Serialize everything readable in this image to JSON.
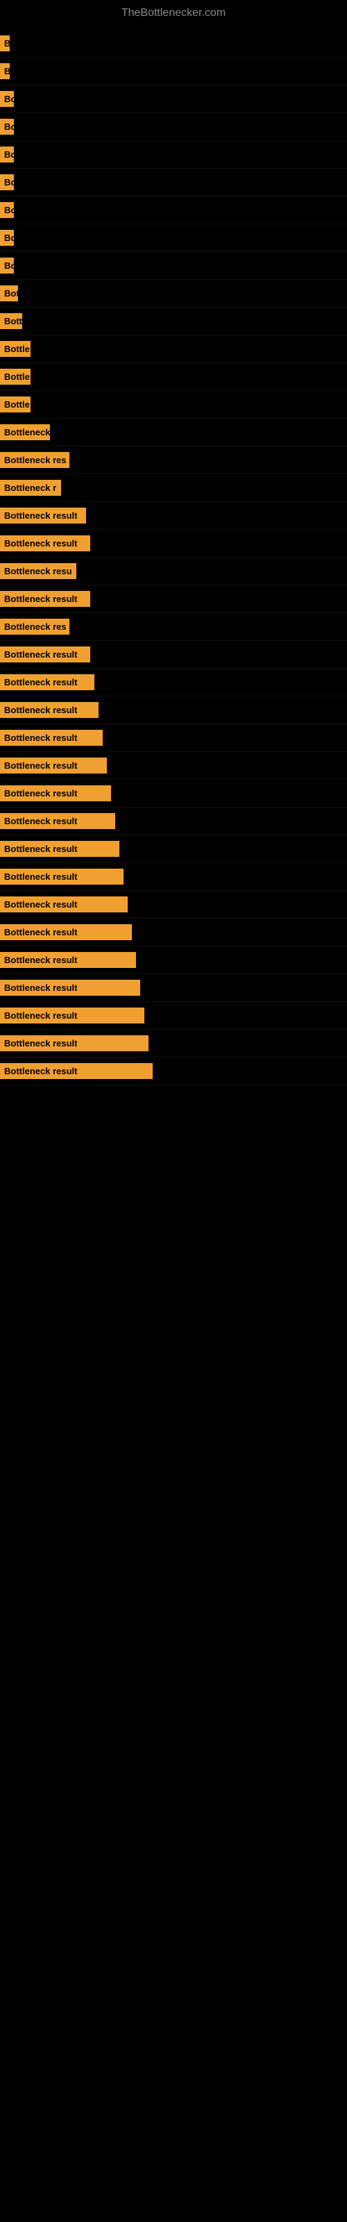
{
  "site": {
    "title": "TheBottlenecker.com"
  },
  "rows": [
    {
      "label": "B",
      "labelWidth": 14,
      "full_text": "B"
    },
    {
      "label": "B",
      "labelWidth": 14,
      "full_text": "B"
    },
    {
      "label": "Bo",
      "labelWidth": 20,
      "full_text": "Bo"
    },
    {
      "label": "Bo",
      "labelWidth": 20,
      "full_text": "Bo"
    },
    {
      "label": "Bo",
      "labelWidth": 20,
      "full_text": "Bo"
    },
    {
      "label": "Bo",
      "labelWidth": 20,
      "full_text": "Bo"
    },
    {
      "label": "Bo",
      "labelWidth": 20,
      "full_text": "Bo"
    },
    {
      "label": "Bo",
      "labelWidth": 20,
      "full_text": "Bo"
    },
    {
      "label": "Bo",
      "labelWidth": 20,
      "full_text": "Bo"
    },
    {
      "label": "Bot",
      "labelWidth": 26,
      "full_text": "Bot"
    },
    {
      "label": "Bott",
      "labelWidth": 32,
      "full_text": "Bott"
    },
    {
      "label": "Bottle",
      "labelWidth": 44,
      "full_text": "Bottle"
    },
    {
      "label": "Bottle",
      "labelWidth": 44,
      "full_text": "Bottle"
    },
    {
      "label": "Bottle",
      "labelWidth": 44,
      "full_text": "Bottle"
    },
    {
      "label": "Bottleneck",
      "labelWidth": 72,
      "full_text": "Bottleneck"
    },
    {
      "label": "Bottleneck res",
      "labelWidth": 100,
      "full_text": "Bottleneck res"
    },
    {
      "label": "Bottleneck r",
      "labelWidth": 88,
      "full_text": "Bottleneck r"
    },
    {
      "label": "Bottleneck result",
      "labelWidth": 124,
      "full_text": "Bottleneck result"
    },
    {
      "label": "Bottleneck result",
      "labelWidth": 130,
      "full_text": "Bottleneck result"
    },
    {
      "label": "Bottleneck resu",
      "labelWidth": 110,
      "full_text": "Bottleneck resu"
    },
    {
      "label": "Bottleneck result",
      "labelWidth": 130,
      "full_text": "Bottleneck result"
    },
    {
      "label": "Bottleneck res",
      "labelWidth": 100,
      "full_text": "Bottleneck res"
    },
    {
      "label": "Bottleneck result",
      "labelWidth": 130,
      "full_text": "Bottleneck result"
    },
    {
      "label": "Bottleneck result",
      "labelWidth": 136,
      "full_text": "Bottleneck result"
    },
    {
      "label": "Bottleneck result",
      "labelWidth": 142,
      "full_text": "Bottleneck result"
    },
    {
      "label": "Bottleneck result",
      "labelWidth": 148,
      "full_text": "Bottleneck result"
    },
    {
      "label": "Bottleneck result",
      "labelWidth": 154,
      "full_text": "Bottleneck result"
    },
    {
      "label": "Bottleneck result",
      "labelWidth": 160,
      "full_text": "Bottleneck result"
    },
    {
      "label": "Bottleneck result",
      "labelWidth": 166,
      "full_text": "Bottleneck result"
    },
    {
      "label": "Bottleneck result",
      "labelWidth": 172,
      "full_text": "Bottleneck result"
    },
    {
      "label": "Bottleneck result",
      "labelWidth": 178,
      "full_text": "Bottleneck result"
    },
    {
      "label": "Bottleneck result",
      "labelWidth": 184,
      "full_text": "Bottleneck result"
    },
    {
      "label": "Bottleneck result",
      "labelWidth": 190,
      "full_text": "Bottleneck result"
    },
    {
      "label": "Bottleneck result",
      "labelWidth": 196,
      "full_text": "Bottleneck result"
    },
    {
      "label": "Bottleneck result",
      "labelWidth": 202,
      "full_text": "Bottleneck result"
    },
    {
      "label": "Bottleneck result",
      "labelWidth": 208,
      "full_text": "Bottleneck result"
    },
    {
      "label": "Bottleneck result",
      "labelWidth": 214,
      "full_text": "Bottleneck result"
    },
    {
      "label": "Bottleneck result",
      "labelWidth": 220,
      "full_text": "Bottleneck result"
    }
  ]
}
